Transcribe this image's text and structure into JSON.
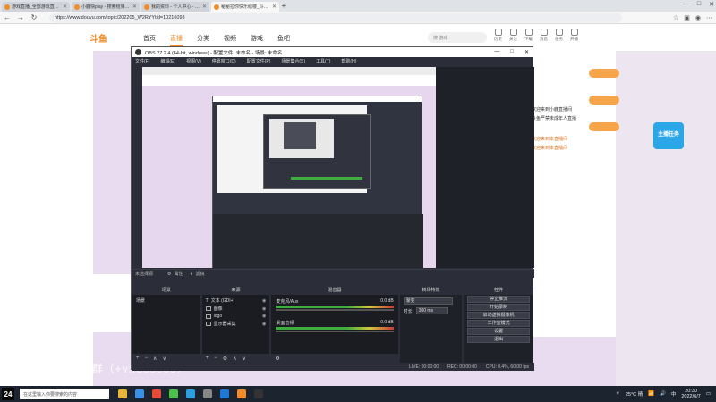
{
  "browser": {
    "tabs": [
      {
        "label": "游戏直播_全部游戏直播_斗鱼直播",
        "active": false
      },
      {
        "label": "小鹿快play - 搜索结果 - 斗鱼直播",
        "active": false
      },
      {
        "label": "我的资料 - 个人中心 - 斗鱼",
        "active": false
      },
      {
        "label": "秘秘拉你快乐结楼_斗鱼直播平台",
        "active": true
      }
    ],
    "url": "https://www.douyu.com/topic/202205_W2RYYtid=10216093",
    "back": "←",
    "forward": "→",
    "reload": "↻",
    "window_controls": {
      "min": "—",
      "max": "□",
      "close": "✕"
    }
  },
  "site": {
    "logo": "斗鱼",
    "nav": [
      "首页",
      "直播",
      "分类",
      "视频",
      "游戏",
      "鱼吧"
    ],
    "active_nav": "直播",
    "search_placeholder": "搜 游戏",
    "icons": [
      "历史",
      "关注",
      "下载",
      "消息",
      "任务",
      "开播"
    ],
    "caption": "5级粉丝群进粉丝群（+v:fuose09）",
    "chat": [
      {
        "text": "欢迎来到小鹿直播间",
        "orange": false
      },
      {
        "text": "斗鱼严禁未成年人直播",
        "orange": false
      },
      {
        "text": "欢迎来到本直播间",
        "orange": true
      },
      {
        "text": "欢迎来到本直播间",
        "orange": true
      }
    ],
    "promo": "主播任务"
  },
  "obs": {
    "title": "OBS 27.2.4 (64-bit, windows) - 配置文件: 未命名 - 场景: 未命名",
    "menu": [
      "文件(F)",
      "编辑(E)",
      "视图(V)",
      "停靠窗口(D)",
      "配置文件(P)",
      "场景集合(S)",
      "工具(T)",
      "帮助(H)"
    ],
    "status_no_source": "未选择源",
    "properties_btn": "属性",
    "filters_btn": "滤镜",
    "docks": {
      "scenes": {
        "title": "场景",
        "items": [
          "场景"
        ]
      },
      "sources": {
        "title": "来源",
        "items": [
          {
            "icon": "text-icon",
            "label": "文本 (GDI+)"
          },
          {
            "icon": "image-icon",
            "label": "图像"
          },
          {
            "icon": "image-icon",
            "label": "logo"
          },
          {
            "icon": "display-icon",
            "label": "显示器采集"
          }
        ]
      },
      "mixer": {
        "title": "混音器",
        "channels": [
          {
            "name": "麦克风/Aux",
            "db": "0.0 dB"
          },
          {
            "name": "桌面音频",
            "db": "0.0 dB"
          }
        ]
      },
      "transitions": {
        "title": "转场特效",
        "type": "渐变",
        "duration_label": "时长",
        "duration": "300 ms"
      },
      "controls": {
        "title": "控件",
        "buttons": [
          "停止推流",
          "开始录制",
          "启动虚拟摄像机",
          "工作室模式",
          "设置",
          "退出"
        ]
      }
    },
    "footer": {
      "live": "LIVE: 00:00:00",
      "rec": "REC: 00:00:00",
      "cpu": "CPU: 0.4%, 60.00 fps"
    }
  },
  "taskbar": {
    "start": "24",
    "search": "在这里输入你要搜索的内容",
    "weather": "25°C 晴",
    "time": "20:30",
    "date": "2022/6/7",
    "lang": "中",
    "app_colors": [
      "#e8b63a",
      "#3a8fe8",
      "#e84a3a",
      "#4ac24a",
      "#2aa0e0",
      "#888888",
      "#1e78d6",
      "#f28c28",
      "#333333"
    ]
  }
}
